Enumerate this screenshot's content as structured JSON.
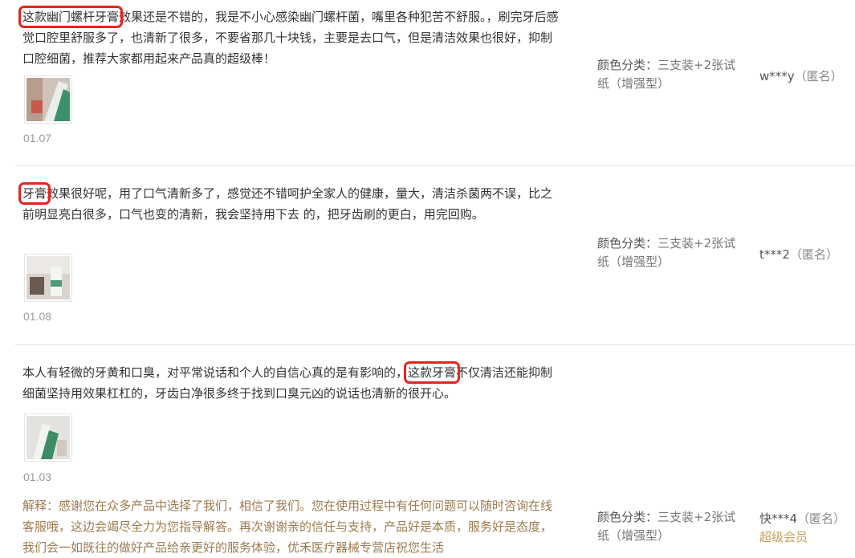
{
  "reviews": [
    {
      "highlight": "这款幽门螺杆牙膏",
      "text": "效果还是不错的，我是不小心感染幽门螺杆菌，嘴里各种犯苦不舒服。，刷完牙后感觉口腔里舒服多了，也清新了很多，不要省那几十块钱，主要是去口气，但是清洁效果也很好，抑制口腔细菌，推荐大家都用起来产品真的超级棒！",
      "date": "01.07",
      "sku_label": "颜色分类：",
      "sku_value": "三支装+2张试纸（增强型）",
      "user": "w***y",
      "anon": "（匿名）"
    },
    {
      "highlight": "牙膏",
      "text": "效果很好呢，用了口气清新多了，感觉还不错呵护全家人的健康，量大，清洁杀菌两不误，比之前明显亮白很多，口气也变的清新，我会坚持用下去 的，把牙齿刷的更白，用完回购。",
      "date": "01.08",
      "sku_label": "颜色分类：",
      "sku_value": "三支装+2张试纸（增强型）",
      "user": "t***2",
      "anon": "（匿名）"
    },
    {
      "text_before": "本人有轻微的牙黄和口臭，对平常说话和个人的自信心真的是有影响的，",
      "highlight": "这款牙膏",
      "text": "不仅清洁还能抑制细菌坚持用效果杠杠的，牙齿白净很多终于找到口臭元凶的说话也清新的很开心。",
      "date": "01.03",
      "reply": "解释：感谢您在众多产品中选择了我们，相信了我们。您在使用过程中有任何问题可以随时咨询在线客服哦，这边会竭尽全力为您指导解答。再次谢谢亲的信任与支持，产品好是本质，服务好是态度，我们会一如既往的做好产品给亲更好的服务体验，优禾医疗器械专营店祝您生活",
      "sku_label": "颜色分类：",
      "sku_value": "三支装+2张试纸（增强型）",
      "user": "快***4",
      "anon": "（匿名）",
      "badge": "超级会员"
    }
  ],
  "colors": {
    "highlight_border": "#e8231f",
    "reply_text": "#9c7a4d",
    "vip_text": "#c9a05a",
    "divider": "#e6e6e6"
  },
  "icons": [
    "review-photo-thumbnail"
  ]
}
